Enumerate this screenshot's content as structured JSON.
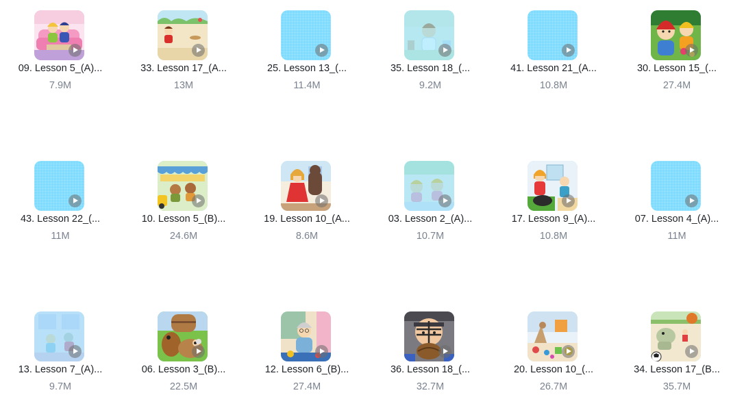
{
  "files": [
    {
      "title": "09. Lesson 5_(A)...",
      "size": "7.9M",
      "thumb": "art",
      "scene": "sofa-couple",
      "faded": false
    },
    {
      "title": "33. Lesson 17_(A...",
      "size": "13M",
      "thumb": "art",
      "scene": "beach",
      "faded": false
    },
    {
      "title": "25. Lesson 13_(...",
      "size": "11.4M",
      "thumb": "blank",
      "scene": "",
      "faded": false
    },
    {
      "title": "35. Lesson 18_(...",
      "size": "9.2M",
      "thumb": "art",
      "scene": "boy-room",
      "faded": true
    },
    {
      "title": "41. Lesson 21_(A...",
      "size": "10.8M",
      "thumb": "blank",
      "scene": "",
      "faded": false
    },
    {
      "title": "30. Lesson 15_(...",
      "size": "27.4M",
      "thumb": "art",
      "scene": "garden-kids",
      "faded": false
    },
    {
      "title": "43. Lesson 22_(...",
      "size": "11M",
      "thumb": "blank",
      "scene": "",
      "faded": false
    },
    {
      "title": "10. Lesson 5_(B)...",
      "size": "24.6M",
      "thumb": "art",
      "scene": "market",
      "faded": false
    },
    {
      "title": "19. Lesson 10_(A...",
      "size": "8.6M",
      "thumb": "art",
      "scene": "girl-bear",
      "faded": false
    },
    {
      "title": "03. Lesson 2_(A)...",
      "size": "10.7M",
      "thumb": "art",
      "scene": "babies",
      "faded": true
    },
    {
      "title": "17. Lesson 9_(A)...",
      "size": "10.8M",
      "thumb": "art",
      "scene": "kitchen",
      "faded": false
    },
    {
      "title": "07. Lesson 4_(A)...",
      "size": "11M",
      "thumb": "blank",
      "scene": "",
      "faded": false
    },
    {
      "title": "13. Lesson 7_(A)...",
      "size": "9.7M",
      "thumb": "art",
      "scene": "pink-room",
      "faded": true
    },
    {
      "title": "06. Lesson 3_(B)...",
      "size": "22.5M",
      "thumb": "art",
      "scene": "dog-garden",
      "faded": false
    },
    {
      "title": "12. Lesson 6_(B)...",
      "size": "27.4M",
      "thumb": "art",
      "scene": "grandma",
      "faded": false
    },
    {
      "title": "36. Lesson 18_(...",
      "size": "32.7M",
      "thumb": "art",
      "scene": "catcher",
      "faded": false
    },
    {
      "title": "20. Lesson 10_(...",
      "size": "26.7M",
      "thumb": "art",
      "scene": "toys",
      "faded": false
    },
    {
      "title": "34. Lesson 17_(B...",
      "size": "35.7M",
      "thumb": "art",
      "scene": "soccer",
      "faded": false
    }
  ],
  "colors": {
    "placeholder": "#7fdcff",
    "title_text": "#1e2227",
    "size_text": "#7b8390"
  },
  "icons": {
    "play": "play-icon"
  }
}
